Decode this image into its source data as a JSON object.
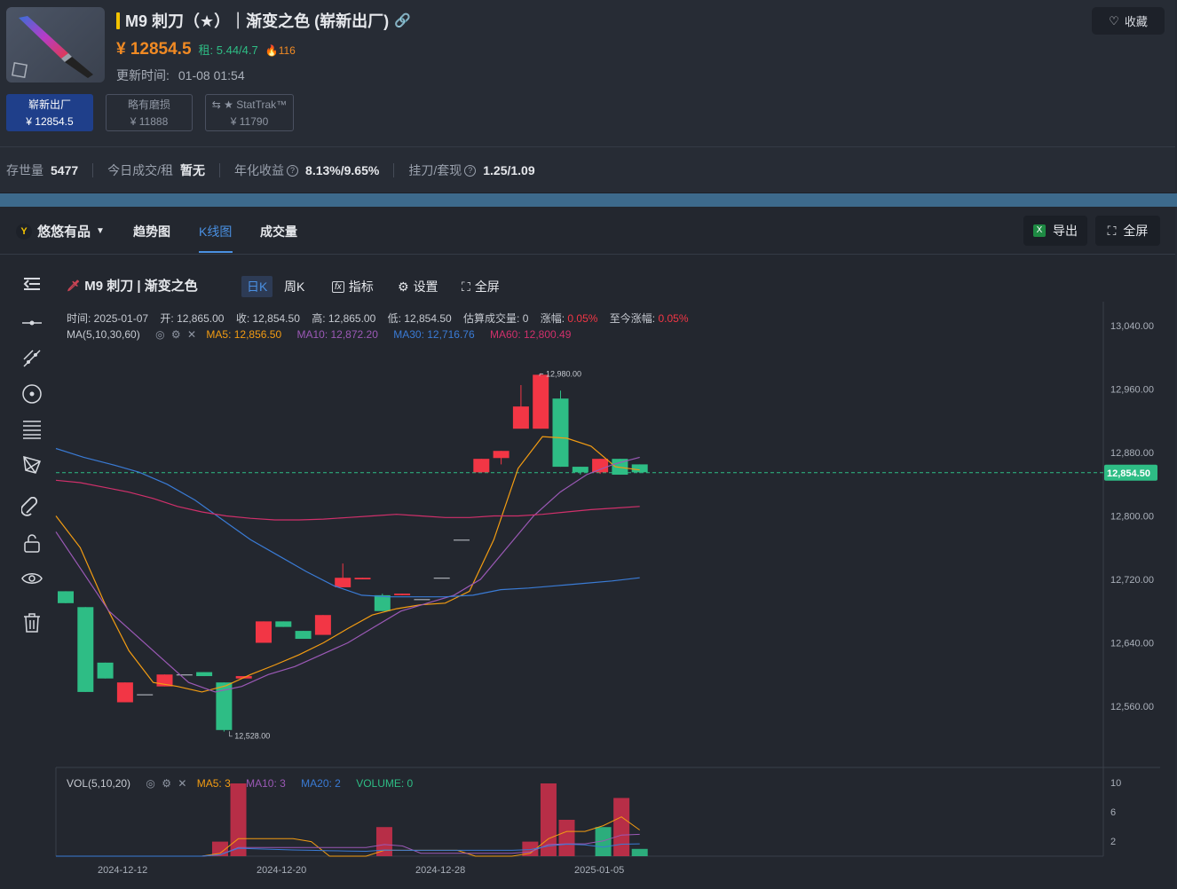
{
  "product": {
    "title": "M9 刺刀（★）｜渐变之色 (崭新出厂)",
    "price": "¥ 12854.5",
    "rent": "租: 5.44/4.7",
    "hot": "116",
    "update_label": "更新时间:",
    "update_time": "01-08 01:54",
    "favorite": "收藏"
  },
  "wear_options": [
    {
      "name": "崭新出厂",
      "price": "¥ 12854.5"
    },
    {
      "name": "略有磨损",
      "price": "¥ 11888"
    },
    {
      "name": "⇆ ★ StatTrak™",
      "price": "¥ 11790"
    }
  ],
  "stats": [
    {
      "label": "存世量",
      "value": "5477"
    },
    {
      "label": "今日成交/租",
      "value": "暂无"
    },
    {
      "label": "年化收益",
      "value": "8.13%/9.65%"
    },
    {
      "label": "挂刀/套现",
      "value": "1.25/1.09"
    }
  ],
  "tabs": {
    "source": "悠悠有品",
    "items": [
      "趋势图",
      "K线图",
      "成交量"
    ],
    "export": "导出",
    "fullscreen": "全屏"
  },
  "toolbar": {
    "item_name": "M9 刺刀 | 渐变之色",
    "day_k": "日K",
    "week_k": "周K",
    "indicator": "指标",
    "settings": "设置",
    "fullscreen": "全屏"
  },
  "kinfo": {
    "time": "时间: 2025-01-07",
    "open": "开: 12,865.00",
    "close": "收: 12,854.50",
    "high": "高: 12,865.00",
    "low": "低: 12,854.50",
    "volume": "估算成交量: 0",
    "change_label": "涨幅:",
    "change": "0.05%",
    "total_label": "至今涨幅:",
    "total": "0.05%",
    "ma_title": "MA(5,10,30,60)",
    "ma5": "MA5: 12,856.50",
    "ma10": "MA10: 12,872.20",
    "ma30": "MA30: 12,716.76",
    "ma60": "MA60: 12,800.49",
    "vol_title": "VOL(5,10,20)",
    "vma5": "MA5: 3",
    "vma10": "MA10: 3",
    "vma20": "MA20: 2",
    "volume_val": "VOLUME: 0"
  },
  "colors": {
    "up": "#f23645",
    "down": "#2ebd85",
    "ma5": "#f39c12",
    "ma10": "#9b59b6",
    "ma30": "#3a7bd5",
    "ma60": "#d0306b"
  },
  "chart_data": {
    "type": "candlestick",
    "y_ticks": [
      "13,040.00",
      "12,960.00",
      "12,880.00",
      "12,800.00",
      "12,720.00",
      "12,640.00",
      "12,560.00"
    ],
    "ylim": [
      12480,
      13040
    ],
    "x_ticks": [
      "2024-12-12",
      "2024-12-20",
      "2024-12-28",
      "2025-01-05"
    ],
    "last_price": "12,854.50",
    "max_label": "12,980.00",
    "min_label": "12,528.00",
    "candles": [
      {
        "o": 12705,
        "c": 12690,
        "h": 12705,
        "l": 12690
      },
      {
        "o": 12685,
        "c": 12578,
        "h": 12685,
        "l": 12578
      },
      {
        "o": 12615,
        "c": 12595,
        "h": 12615,
        "l": 12595
      },
      {
        "o": 12565,
        "c": 12590,
        "h": 12590,
        "l": 12565
      },
      {
        "o": 12575,
        "c": 12575,
        "h": 12575,
        "l": 12575
      },
      {
        "o": 12585,
        "c": 12600,
        "h": 12600,
        "l": 12585
      },
      {
        "o": 12600,
        "c": 12600,
        "h": 12600,
        "l": 12600
      },
      {
        "o": 12603,
        "c": 12598,
        "h": 12603,
        "l": 12598
      },
      {
        "o": 12590,
        "c": 12530,
        "h": 12590,
        "l": 12528
      },
      {
        "o": 12595,
        "c": 12598,
        "h": 12598,
        "l": 12595
      },
      {
        "o": 12640,
        "c": 12667,
        "h": 12667,
        "l": 12640
      },
      {
        "o": 12667,
        "c": 12660,
        "h": 12667,
        "l": 12660
      },
      {
        "o": 12655,
        "c": 12645,
        "h": 12655,
        "l": 12645
      },
      {
        "o": 12650,
        "c": 12675,
        "h": 12675,
        "l": 12650
      },
      {
        "o": 12710,
        "c": 12722,
        "h": 12740,
        "l": 12710
      },
      {
        "o": 12720,
        "c": 12722,
        "h": 12722,
        "l": 12720
      },
      {
        "o": 12700,
        "c": 12680,
        "h": 12702,
        "l": 12680
      },
      {
        "o": 12700,
        "c": 12702,
        "h": 12702,
        "l": 12700
      },
      {
        "o": 12695,
        "c": 12695,
        "h": 12695,
        "l": 12695
      },
      {
        "o": 12722,
        "c": 12722,
        "h": 12722,
        "l": 12722
      },
      {
        "o": 12770,
        "c": 12770,
        "h": 12770,
        "l": 12770
      },
      {
        "o": 12855,
        "c": 12872,
        "h": 12872,
        "l": 12855
      },
      {
        "o": 12873,
        "c": 12882,
        "h": 12882,
        "l": 12865
      },
      {
        "o": 12910,
        "c": 12938,
        "h": 12965,
        "l": 12910
      },
      {
        "o": 12910,
        "c": 12978,
        "h": 12980,
        "l": 12910
      },
      {
        "o": 12948,
        "c": 12862,
        "h": 12958,
        "l": 12862
      },
      {
        "o": 12862,
        "c": 12855,
        "h": 12862,
        "l": 12852
      },
      {
        "o": 12855,
        "c": 12872,
        "h": 12872,
        "l": 12853
      },
      {
        "o": 12872,
        "c": 12852,
        "h": 12872,
        "l": 12852
      },
      {
        "o": 12865,
        "c": 12855,
        "h": 12865,
        "l": 12854
      }
    ],
    "ma5": [
      12800,
      12760,
      12690,
      12630,
      12590,
      12585,
      12578,
      12586,
      12600,
      12612,
      12625,
      12640,
      12658,
      12675,
      12683,
      12688,
      12690,
      12705,
      12770,
      12860,
      12900,
      12898,
      12888,
      12862,
      12858
    ],
    "ma10": [
      12780,
      12730,
      12680,
      12650,
      12620,
      12590,
      12578,
      12585,
      12600,
      12610,
      12625,
      12640,
      12660,
      12680,
      12690,
      12700,
      12720,
      12760,
      12800,
      12830,
      12852,
      12865,
      12874
    ],
    "ma30": [
      12885,
      12874,
      12865,
      12855,
      12840,
      12820,
      12795,
      12770,
      12750,
      12730,
      12712,
      12700,
      12698,
      12698,
      12698,
      12700,
      12707,
      12709,
      12712,
      12715,
      12718,
      12722
    ],
    "ma60": [
      12845,
      12842,
      12836,
      12830,
      12822,
      12812,
      12805,
      12800,
      12797,
      12795,
      12795,
      12796,
      12798,
      12800,
      12802,
      12800,
      12798,
      12798,
      12800,
      12800,
      12802,
      12805,
      12808,
      12810,
      12812
    ],
    "volume": [
      0,
      0,
      0,
      0,
      0,
      0,
      0,
      0,
      0,
      2,
      10,
      0,
      0,
      0,
      0,
      0,
      0,
      0,
      4,
      0,
      0,
      0,
      0,
      0,
      0,
      0,
      2,
      10,
      5,
      0,
      4,
      8,
      1
    ],
    "vol_ticks": [
      "10",
      "6",
      "2"
    ]
  }
}
